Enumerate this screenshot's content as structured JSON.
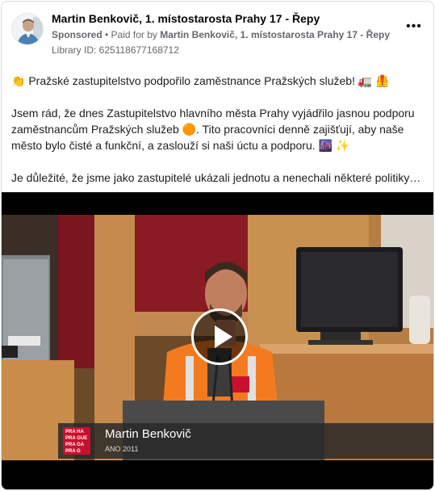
{
  "header": {
    "page_name": "Martin Benkovič, 1. místostarosta Prahy 17 - Řepy",
    "sponsored_label": "Sponsored",
    "separator": " • ",
    "paid_for_prefix": "Paid for by ",
    "paid_for_by": "Martin Benkovič, 1. místostarosta Prahy 17 - Řepy",
    "library_id": "Library ID: 625118677168712",
    "more_label": "•••"
  },
  "post": {
    "line1": "👏 Pražské zastupitelstvo podpořilo zaměstnance Pražských služeb! 🚛 🦺",
    "line2": "Jsem rád, že dnes Zastupitelstvo hlavního města Prahy vyjádřilo jasnou podporu",
    "line3": "zaměstnancům Pražských služeb 🟠. Tito pracovníci denně zajišťují, aby naše",
    "line4": "město bylo čisté a funkční, a zaslouží si naši úctu a podporu. 🌆 ✨",
    "line5": "Je důležité, že jsme jako zastupitelé ukázali jednotu a nenechali některé politiky…"
  },
  "video": {
    "lower_third_name": "Martin Benkovič",
    "lower_third_party": "ANO 2011",
    "logo_lines": [
      "PRA HA",
      "PRA GUE",
      "PRA GA",
      "PRA G"
    ]
  },
  "colors": {
    "meta": "#65676b",
    "vest": "#f47a20",
    "logo_red": "#c8102e"
  }
}
